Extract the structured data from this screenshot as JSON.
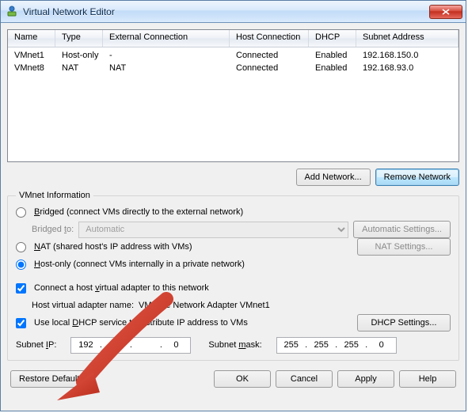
{
  "window": {
    "title": "Virtual Network Editor"
  },
  "table": {
    "headers": {
      "name": "Name",
      "type": "Type",
      "ext": "External Connection",
      "host": "Host Connection",
      "dhcp": "DHCP",
      "sub": "Subnet Address"
    },
    "rows": [
      {
        "name": "VMnet1",
        "type": "Host-only",
        "ext": "-",
        "host": "Connected",
        "dhcp": "Enabled",
        "sub": "192.168.150.0"
      },
      {
        "name": "VMnet8",
        "type": "NAT",
        "ext": "NAT",
        "host": "Connected",
        "dhcp": "Enabled",
        "sub": "192.168.93.0"
      }
    ]
  },
  "buttons": {
    "add": "Add Network...",
    "remove": "Remove Network",
    "autoset": "Automatic Settings...",
    "natset": "NAT Settings...",
    "dhcpset": "DHCP Settings...",
    "restore": "Restore Default",
    "ok": "OK",
    "cancel": "Cancel",
    "apply": "Apply",
    "help": "Help"
  },
  "group": {
    "legend": "VMnet Information",
    "bridged_prefix": "B",
    "bridged_mid": "ridged (connect VMs directly to the external network)",
    "bridged_to": "Bridged ",
    "bridged_to_u": "t",
    "bridged_to_post": "o:",
    "bridged_combo": "Automatic",
    "nat_u": "N",
    "nat_rest": "AT (shared host's IP address with VMs)",
    "host_u": "H",
    "host_rest": "ost-only (connect VMs internally in a private network)",
    "virt_pre": "Connect a host ",
    "virt_u": "v",
    "virt_rest": "irtual adapter to this network",
    "virt_name_label": "Host virtual adapter name: ",
    "virt_name_value": "VMware Network Adapter VMnet1",
    "dhcp_pre": "Use local ",
    "dhcp_u": "D",
    "dhcp_rest": "HCP service to distribute IP address to VMs",
    "subnet_pre": "Subnet ",
    "subnet_u": "I",
    "subnet_post": "P:",
    "mask_pre": "Subnet ",
    "mask_u": "m",
    "mask_post": "ask:",
    "ip1": "192",
    "ip2": "168",
    "ip3": "",
    "ip4": "0",
    "mk1": "255",
    "mk2": "255",
    "mk3": "255",
    "mk4": "0"
  }
}
